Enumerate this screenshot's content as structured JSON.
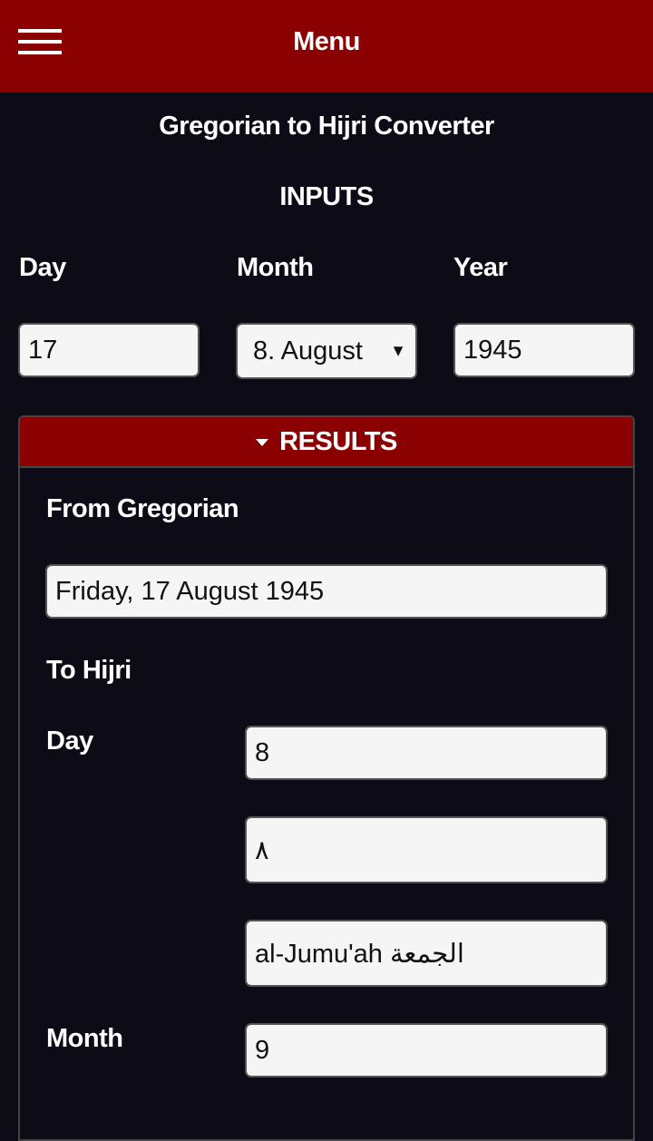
{
  "header": {
    "menu_icon": "hamburger-menu-icon",
    "title": "Menu"
  },
  "page": {
    "title": "Gregorian to Hijri Converter",
    "inputs_heading": "INPUTS"
  },
  "inputs": {
    "day_label": "Day",
    "month_label": "Month",
    "year_label": "Year",
    "day_value": "17",
    "month_selected": "8. August",
    "month_arrow": "▼",
    "year_value": "1945"
  },
  "results": {
    "toggle_icon": "triangle-down-icon",
    "heading": "RESULTS",
    "from_label": "From Gregorian",
    "from_value": "Friday, 17 August 1945",
    "to_label": "To Hijri",
    "day_label": "Day",
    "day_value": "8",
    "day_value_arabic": "٨",
    "weekday_value": "al-Jumu'ah الجمعة",
    "month_label": "Month",
    "month_value": "9"
  },
  "colors": {
    "accent": "#8b0000",
    "background": "#0d0c16",
    "field_bg": "#f5f5f5"
  }
}
